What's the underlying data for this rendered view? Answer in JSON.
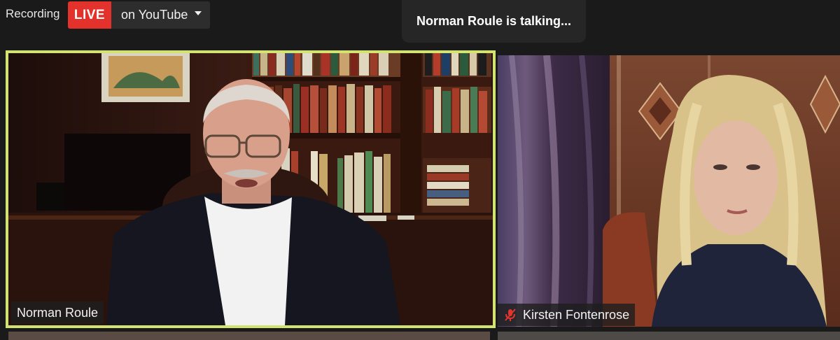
{
  "topbar": {
    "recording_label": "Recording",
    "live_label": "LIVE",
    "live_destination": "on YouTube",
    "talking_indicator": "Norman Roule is talking..."
  },
  "participants": [
    {
      "name": "Norman Roule",
      "active_speaker": true,
      "muted": false
    },
    {
      "name": "Kirsten Fontenrose",
      "active_speaker": false,
      "muted": true
    }
  ],
  "colors": {
    "background": "#1a1a1a",
    "live_red": "#e3322b",
    "active_speaker_border": "#d3e371",
    "mute_red": "#e0342f"
  },
  "icons": [
    "chevron-down-icon",
    "muted-microphone-icon"
  ]
}
